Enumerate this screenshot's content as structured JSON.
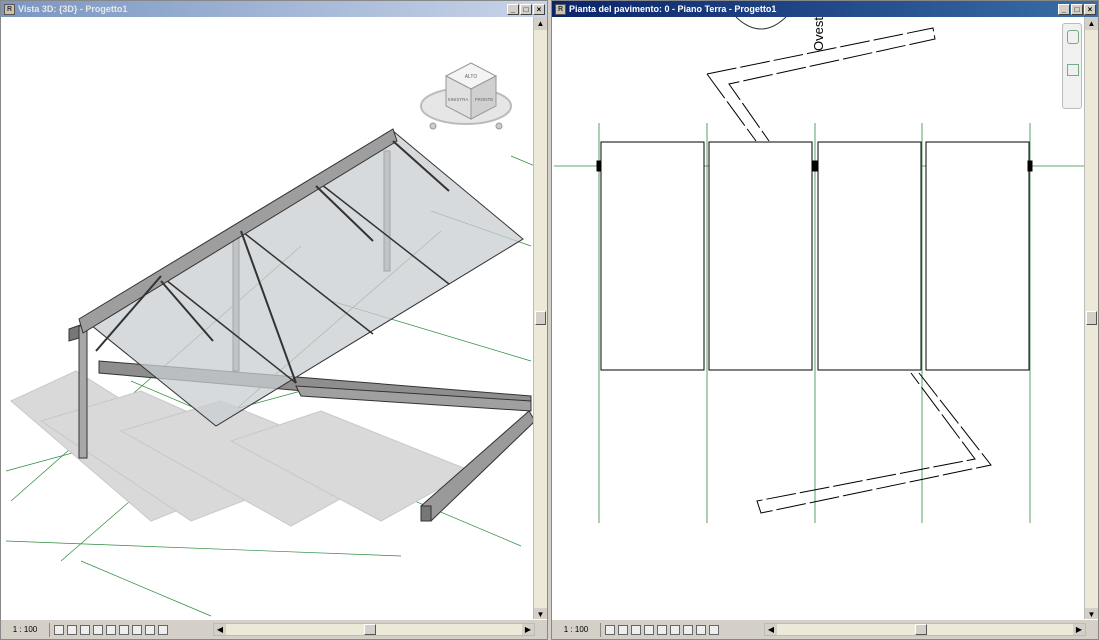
{
  "left_window": {
    "title": "Vista 3D: {3D} - Progetto1",
    "scale": "1 : 100",
    "viewcube": {
      "top_label": "ALTO",
      "left_label": "SINISTRA",
      "front_label": "FRONTE"
    },
    "icons": [
      "detail-level-icon",
      "visual-style-icon",
      "sun-path-icon",
      "shadows-icon",
      "crop-icon",
      "show-crop-icon",
      "lock-view-icon",
      "temp-hide-icon",
      "reveal-hidden-icon"
    ]
  },
  "right_window": {
    "title": "Pianta del pavimento: 0 - Piano Terra - Progetto1",
    "scale": "1 : 100",
    "elevation_label": "Ovest",
    "icons": [
      "detail-level-icon",
      "visual-style-icon",
      "sun-path-icon",
      "shadows-icon",
      "crop-icon",
      "show-crop-icon",
      "lock-view-icon",
      "temp-hide-icon",
      "reveal-hidden-icon"
    ]
  },
  "window_buttons": {
    "minimize": "_",
    "restore": "□",
    "close": "×"
  },
  "colors": {
    "grid_line": "#2e8b3e",
    "active_title": "#0a246a",
    "inactive_title": "#7a96c2"
  }
}
